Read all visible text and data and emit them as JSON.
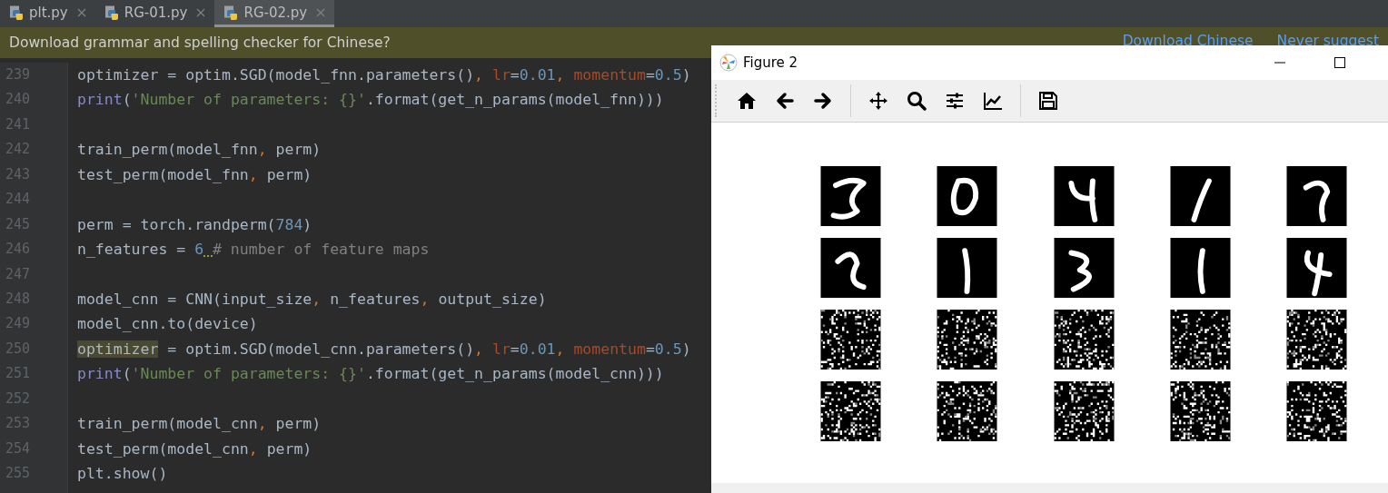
{
  "tabs": [
    {
      "label": "plt.py",
      "selected": false
    },
    {
      "label": "RG-01.py",
      "selected": false
    },
    {
      "label": "RG-02.py",
      "selected": true
    }
  ],
  "notification": {
    "message": "Download grammar and spelling checker for Chinese?",
    "links": [
      "Download Chinese",
      "Never suggest"
    ]
  },
  "editor": {
    "lines": [
      {
        "number": "239",
        "tokens": [
          {
            "text": "optimizer = optim.SGD(model_fnn.parameters()",
            "kind": "plain"
          },
          {
            "text": ", ",
            "kind": "punct"
          },
          {
            "text": "lr",
            "kind": "param"
          },
          {
            "text": "=",
            "kind": "plain"
          },
          {
            "text": "0.01",
            "kind": "num"
          },
          {
            "text": ", ",
            "kind": "punct"
          },
          {
            "text": "momentum",
            "kind": "param"
          },
          {
            "text": "=",
            "kind": "plain"
          },
          {
            "text": "0.5",
            "kind": "num"
          },
          {
            "text": ")",
            "kind": "plain"
          }
        ]
      },
      {
        "number": "240",
        "tokens": [
          {
            "text": "print",
            "kind": "builtin"
          },
          {
            "text": "(",
            "kind": "plain"
          },
          {
            "text": "'Number of parameters: {}'",
            "kind": "str"
          },
          {
            "text": ".format(get_n_params(model_fnn)))",
            "kind": "plain"
          }
        ]
      },
      {
        "number": "241"
      },
      {
        "number": "242",
        "tokens": [
          {
            "text": "train_perm(model_fnn",
            "kind": "plain"
          },
          {
            "text": ", ",
            "kind": "punct"
          },
          {
            "text": "perm)",
            "kind": "plain"
          }
        ]
      },
      {
        "number": "243",
        "tokens": [
          {
            "text": "test_perm(model_fnn",
            "kind": "plain"
          },
          {
            "text": ", ",
            "kind": "punct"
          },
          {
            "text": "perm)",
            "kind": "plain"
          }
        ]
      },
      {
        "number": "244"
      },
      {
        "number": "245",
        "tokens": [
          {
            "text": "perm = torch.randperm(",
            "kind": "plain"
          },
          {
            "text": "784",
            "kind": "num"
          },
          {
            "text": ")",
            "kind": "plain"
          }
        ]
      },
      {
        "number": "246",
        "tokens": [
          {
            "text": "n_features = ",
            "kind": "plain"
          },
          {
            "text": "6",
            "kind": "num",
            "warning": true
          },
          {
            "text": "# number of feature maps",
            "kind": "comment"
          }
        ]
      },
      {
        "number": "247"
      },
      {
        "number": "248",
        "tokens": [
          {
            "text": "model_cnn = CNN(input_size",
            "kind": "plain"
          },
          {
            "text": ", ",
            "kind": "punct"
          },
          {
            "text": "n_features",
            "kind": "plain"
          },
          {
            "text": ", ",
            "kind": "punct"
          },
          {
            "text": "output_size)",
            "kind": "plain"
          }
        ]
      },
      {
        "number": "249",
        "tokens": [
          {
            "text": "model_cnn.to(device)",
            "kind": "plain"
          }
        ]
      },
      {
        "number": "250",
        "tokens": [
          {
            "text": "optimizer",
            "kind": "highlight"
          },
          {
            "text": " = optim.SGD(model_cnn.parameters()",
            "kind": "plain"
          },
          {
            "text": ", ",
            "kind": "punct"
          },
          {
            "text": "lr",
            "kind": "param"
          },
          {
            "text": "=",
            "kind": "plain"
          },
          {
            "text": "0.01",
            "kind": "num"
          },
          {
            "text": ", ",
            "kind": "punct"
          },
          {
            "text": "momentum",
            "kind": "param"
          },
          {
            "text": "=",
            "kind": "plain"
          },
          {
            "text": "0.5",
            "kind": "num"
          },
          {
            "text": ")",
            "kind": "plain"
          }
        ]
      },
      {
        "number": "251",
        "tokens": [
          {
            "text": "print",
            "kind": "builtin"
          },
          {
            "text": "(",
            "kind": "plain"
          },
          {
            "text": "'Number of parameters: {}'",
            "kind": "str"
          },
          {
            "text": ".format(get_n_params(model_cnn)))",
            "kind": "plain"
          }
        ]
      },
      {
        "number": "252"
      },
      {
        "number": "253",
        "tokens": [
          {
            "text": "train_perm(model_cnn",
            "kind": "plain"
          },
          {
            "text": ", ",
            "kind": "punct"
          },
          {
            "text": "perm)",
            "kind": "plain"
          }
        ]
      },
      {
        "number": "254",
        "tokens": [
          {
            "text": "test_perm(model_cnn",
            "kind": "plain"
          },
          {
            "text": ", ",
            "kind": "punct"
          },
          {
            "text": "perm)",
            "kind": "plain"
          }
        ]
      },
      {
        "number": "255",
        "tokens": [
          {
            "text": "plt.show()",
            "kind": "plain"
          }
        ]
      }
    ]
  },
  "figure_window": {
    "title": "Figure 2",
    "panels": [
      {
        "kind": "digit"
      },
      {
        "kind": "digit"
      },
      {
        "kind": "digit"
      },
      {
        "kind": "digit"
      },
      {
        "kind": "digit"
      },
      {
        "kind": "digit"
      },
      {
        "kind": "digit"
      },
      {
        "kind": "digit"
      },
      {
        "kind": "digit"
      },
      {
        "kind": "digit"
      },
      {
        "kind": "noise"
      },
      {
        "kind": "noise"
      },
      {
        "kind": "noise"
      },
      {
        "kind": "noise"
      },
      {
        "kind": "noise"
      },
      {
        "kind": "noise"
      },
      {
        "kind": "noise"
      },
      {
        "kind": "noise"
      },
      {
        "kind": "noise"
      },
      {
        "kind": "noise"
      }
    ]
  }
}
